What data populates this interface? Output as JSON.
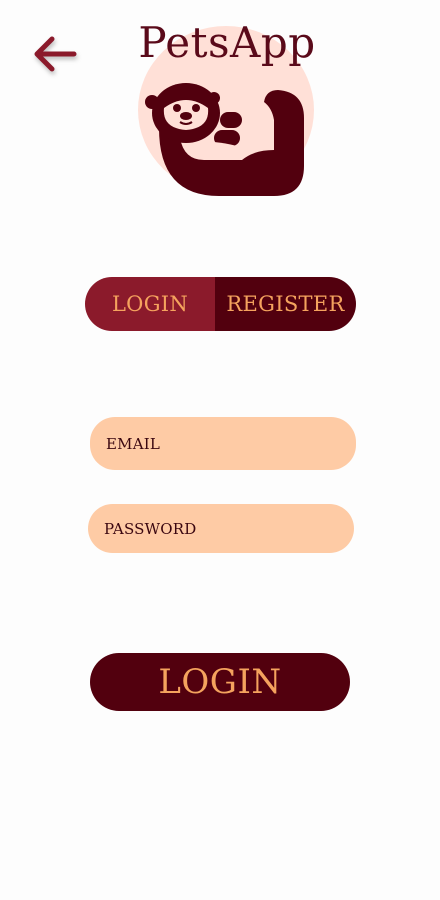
{
  "header": {
    "title": "PetsApp",
    "back_icon": "arrow-left-icon",
    "logo_icon": "otter-icon"
  },
  "auth_toggle": {
    "login_label": "LOGIN",
    "register_label": "REGISTER",
    "selected": "LOGIN"
  },
  "form": {
    "email_placeholder": "EMAIL",
    "password_placeholder": "PASSWORD",
    "submit_label": "LOGIN"
  },
  "colors": {
    "background": "#fdfdfd",
    "brand_dark": "#52000e",
    "brand_mid": "#8b1a2b",
    "accent_text": "#f5a35e",
    "input_bg": "#fecba5",
    "logo_circle": "#ffe0d7"
  }
}
